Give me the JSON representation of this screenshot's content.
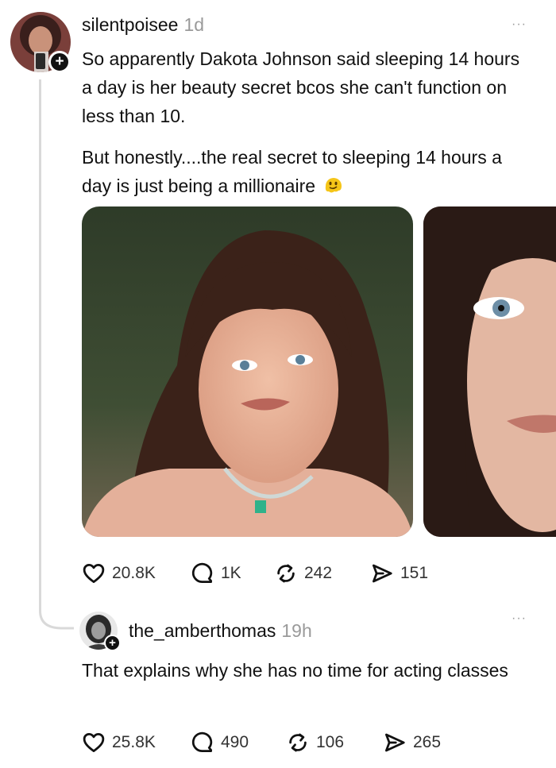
{
  "post": {
    "username": "silentpoisee",
    "time": "1d",
    "more": "···",
    "paragraph1": "So apparently Dakota Johnson said sleeping 14 hours a day is her beauty secret bcos she can't function on less than 10.",
    "paragraph2": "But honestly....the real secret to sleeping 14 hours a day is just being a millionaire",
    "emoji": "melting-face-emoji",
    "likes": "20.8K",
    "comments": "1K",
    "reposts": "242",
    "shares": "151"
  },
  "reply": {
    "username": "the_amberthomas",
    "time": "19h",
    "more": "···",
    "text": "That explains why she has no time for acting classes",
    "likes": "25.8K",
    "comments": "490",
    "reposts": "106",
    "shares": "265"
  },
  "icons": {
    "heart": "heart-icon",
    "comment": "comment-icon",
    "repost": "repost-icon",
    "share": "share-icon",
    "follow": "plus-icon"
  }
}
